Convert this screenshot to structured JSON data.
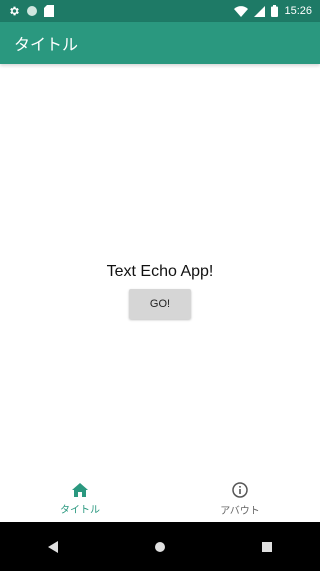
{
  "status_bar": {
    "time": "15:26",
    "icons_left": [
      "gear-icon",
      "circle-icon",
      "sd-card-icon"
    ],
    "icons_right": [
      "wifi-icon",
      "signal-icon",
      "battery-icon"
    ],
    "background": "#1E7A66"
  },
  "app_bar": {
    "title": "タイトル",
    "background": "#2A987F"
  },
  "main": {
    "title": "Text Echo App!",
    "go_button_label": "GO!"
  },
  "bottom_nav": {
    "items": [
      {
        "label": "タイトル",
        "icon": "home-icon",
        "active": true
      },
      {
        "label": "アバウト",
        "icon": "info-icon",
        "active": false
      }
    ],
    "active_color": "#2A987F"
  },
  "system_nav": {
    "buttons": [
      "back-icon",
      "home-circle-icon",
      "recents-icon"
    ]
  }
}
